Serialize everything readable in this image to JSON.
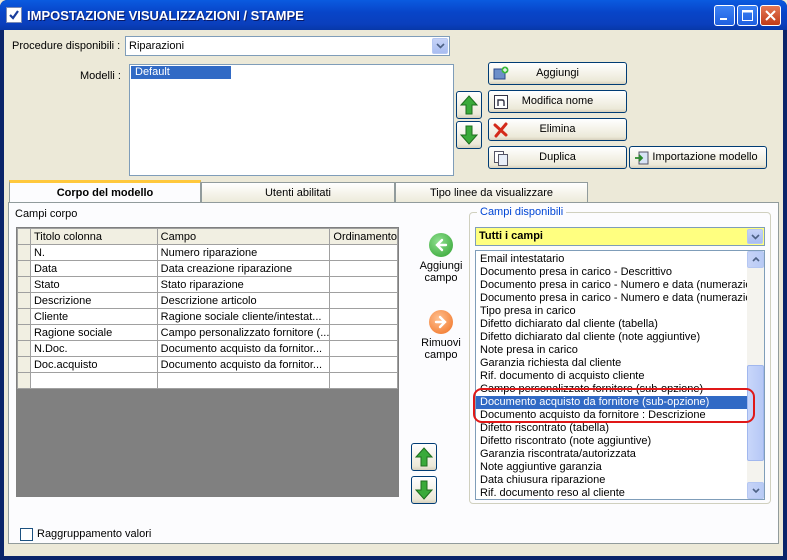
{
  "window": {
    "title": "IMPOSTAZIONE VISUALIZZAZIONI / STAMPE"
  },
  "procedure": {
    "label": "Procedure disponibili :",
    "selected": "Riparazioni"
  },
  "modelli": {
    "label": "Modelli :",
    "items": [
      "Default"
    ]
  },
  "buttons": {
    "aggiungi": "Aggiungi",
    "modifica_nome": "Modifica nome",
    "elimina": "Elimina",
    "duplica": "Duplica",
    "importazione": "Importazione modello"
  },
  "tabs": [
    {
      "label": "Corpo del modello",
      "active": true
    },
    {
      "label": "Utenti abilitati",
      "active": false
    },
    {
      "label": "Tipo linee da visualizzare",
      "active": false
    }
  ],
  "campi_corpo": {
    "label": "Campi corpo",
    "columns": [
      "Titolo colonna",
      "Campo",
      "Ordinamento"
    ],
    "rows": [
      [
        "N.",
        "Numero riparazione",
        ""
      ],
      [
        "Data",
        "Data creazione riparazione",
        ""
      ],
      [
        "Stato",
        "Stato riparazione",
        ""
      ],
      [
        "Descrizione",
        "Descrizione articolo",
        ""
      ],
      [
        "Cliente",
        "Ragione sociale cliente/intestat...",
        ""
      ],
      [
        "Ragione sociale",
        "Campo personalizzato fornitore (...",
        ""
      ],
      [
        "N.Doc.",
        "Documento acquisto da fornitor...",
        ""
      ],
      [
        "Doc.acquisto",
        "Documento acquisto da fornitor...",
        ""
      ],
      [
        "",
        "",
        ""
      ]
    ]
  },
  "actions": {
    "aggiungi_campo": [
      "Aggiungi",
      "campo"
    ],
    "rimuovi_campo": [
      "Rimuovi",
      "campo"
    ]
  },
  "campi_disponibili": {
    "label": "Campi disponibili",
    "filter": "Tutti i campi",
    "items": [
      "Email intestatario",
      "Documento presa in carico - Descrittivo",
      "Documento presa in carico - Numero e data (numerazione",
      "Documento presa in carico - Numero e data (numerazione",
      "Tipo presa in carico",
      "Difetto dichiarato dal cliente (tabella)",
      "Difetto dichiarato dal cliente (note aggiuntive)",
      "Note presa in carico",
      "Garanzia richiesta dal cliente",
      "Rif. documento di acquisto cliente",
      "Campo personalizzato fornitore (sub-opzione)",
      "Documento acquisto da fornitore (sub-opzione)",
      "Documento acquisto da fornitore : Descrizione",
      "Difetto riscontrato (tabella)",
      "Difetto riscontrato (note aggiuntive)",
      "Garanzia riscontrata/autorizzata",
      "Note aggiuntive garanzia",
      "Data chiusura riparazione",
      "Rif. documento reso al cliente"
    ],
    "selected_index": 11
  },
  "raggruppamento": {
    "label": "Raggruppamento valori",
    "checked": false
  },
  "colors": {
    "highlight_ring": "#e01818",
    "selection": "#316ac5",
    "filter_bg": "#ffff80",
    "arrow_green": "#2fa02f",
    "arrow_orange": "#f07020"
  }
}
